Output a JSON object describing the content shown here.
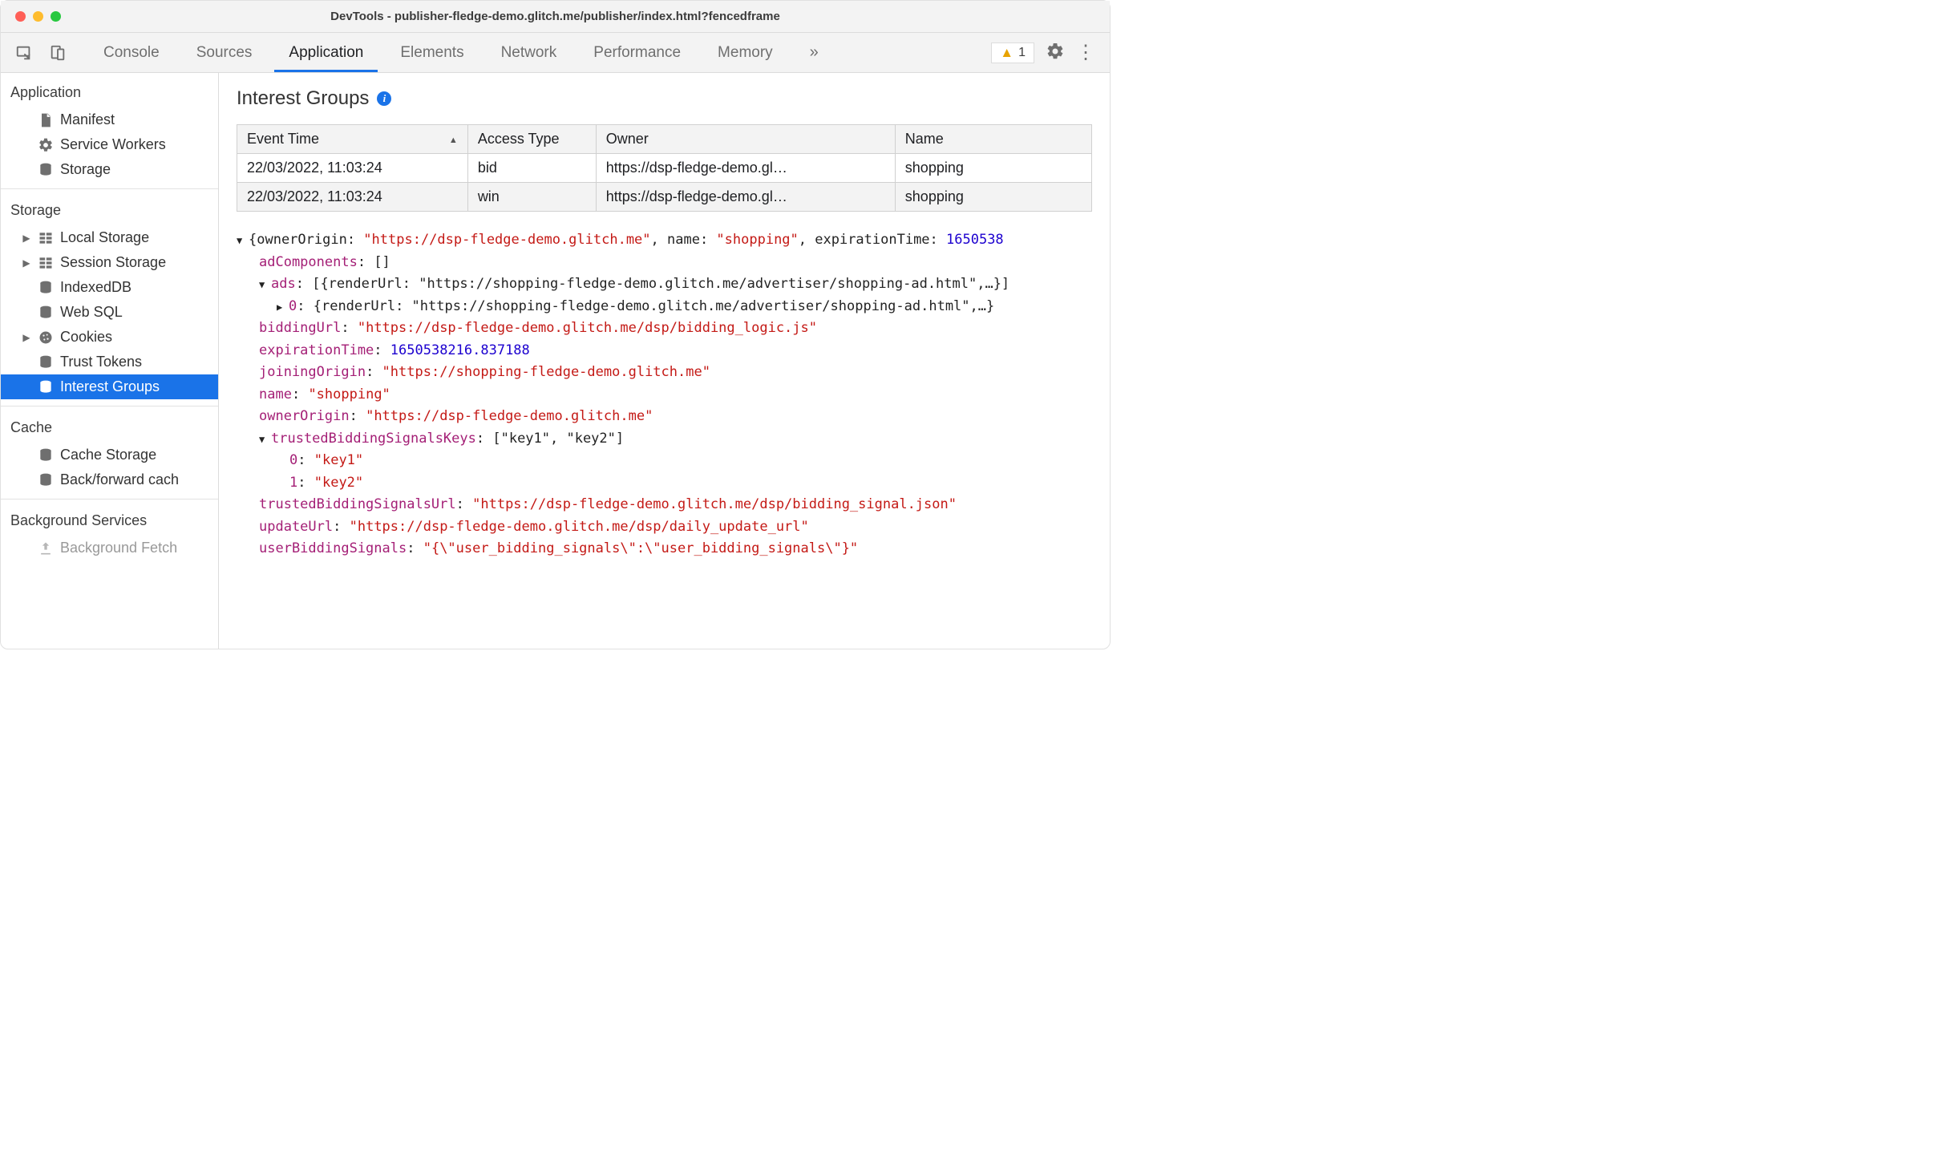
{
  "window": {
    "title": "DevTools - publisher-fledge-demo.glitch.me/publisher/index.html?fencedframe"
  },
  "tabs": {
    "console": "Console",
    "sources": "Sources",
    "application": "Application",
    "elements": "Elements",
    "network": "Network",
    "performance": "Performance",
    "memory": "Memory"
  },
  "warnings": {
    "count": "1"
  },
  "sidebar": {
    "application": {
      "title": "Application",
      "manifest": "Manifest",
      "service_workers": "Service Workers",
      "storage": "Storage"
    },
    "storage": {
      "title": "Storage",
      "local_storage": "Local Storage",
      "session_storage": "Session Storage",
      "indexeddb": "IndexedDB",
      "websql": "Web SQL",
      "cookies": "Cookies",
      "trust_tokens": "Trust Tokens",
      "interest_groups": "Interest Groups"
    },
    "cache": {
      "title": "Cache",
      "cache_storage": "Cache Storage",
      "back_forward": "Back/forward cach"
    },
    "background": {
      "title": "Background Services",
      "fetch": "Background Fetch"
    }
  },
  "panel": {
    "heading": "Interest Groups",
    "columns": {
      "event_time": "Event Time",
      "access_type": "Access Type",
      "owner": "Owner",
      "name": "Name"
    },
    "rows": [
      {
        "time": "22/03/2022, 11:03:24",
        "access": "bid",
        "owner": "https://dsp-fledge-demo.gl…",
        "name": "shopping"
      },
      {
        "time": "22/03/2022, 11:03:24",
        "access": "win",
        "owner": "https://dsp-fledge-demo.gl…",
        "name": "shopping"
      }
    ]
  },
  "detail": {
    "line0_a": "{ownerOrigin: ",
    "line0_b": "\"https://dsp-fledge-demo.glitch.me\"",
    "line0_c": ", name: ",
    "line0_d": "\"shopping\"",
    "line0_e": ", expirationTime: ",
    "line0_f": "1650538",
    "adComponents_k": "adComponents",
    "adComponents_v": "[]",
    "ads_k": "ads",
    "ads_v": "[{renderUrl: \"https://shopping-fledge-demo.glitch.me/advertiser/shopping-ad.html\",…}]",
    "ads0_k": "0",
    "ads0_v": "{renderUrl: \"https://shopping-fledge-demo.glitch.me/advertiser/shopping-ad.html\",…}",
    "biddingUrl_k": "biddingUrl",
    "biddingUrl_v": "\"https://dsp-fledge-demo.glitch.me/dsp/bidding_logic.js\"",
    "expirationTime_k": "expirationTime",
    "expirationTime_v": "1650538216.837188",
    "joiningOrigin_k": "joiningOrigin",
    "joiningOrigin_v": "\"https://shopping-fledge-demo.glitch.me\"",
    "name_k": "name",
    "name_v": "\"shopping\"",
    "ownerOrigin_k": "ownerOrigin",
    "ownerOrigin_v": "\"https://dsp-fledge-demo.glitch.me\"",
    "tbsk_k": "trustedBiddingSignalsKeys",
    "tbsk_v": "[\"key1\", \"key2\"]",
    "tbsk0_k": "0",
    "tbsk0_v": "\"key1\"",
    "tbsk1_k": "1",
    "tbsk1_v": "\"key2\"",
    "tbsu_k": "trustedBiddingSignalsUrl",
    "tbsu_v": "\"https://dsp-fledge-demo.glitch.me/dsp/bidding_signal.json\"",
    "updateUrl_k": "updateUrl",
    "updateUrl_v": "\"https://dsp-fledge-demo.glitch.me/dsp/daily_update_url\"",
    "ubs_k": "userBiddingSignals",
    "ubs_v": "\"{\\\"user_bidding_signals\\\":\\\"user_bidding_signals\\\"}\""
  }
}
